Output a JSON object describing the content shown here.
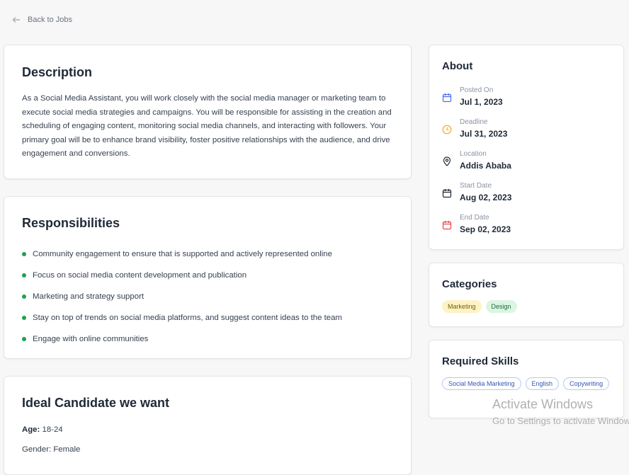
{
  "back": {
    "label": "Back to Jobs"
  },
  "description": {
    "title": "Description",
    "text": "As a Social Media Assistant, you will work closely with the social media manager or marketing team to execute social media strategies and campaigns. You will be responsible for assisting in the creation and scheduling of engaging content, monitoring social media channels, and interacting with followers. Your primary goal will be to enhance brand visibility, foster positive relationships with the audience, and drive engagement and conversions."
  },
  "responsibilities": {
    "title": "Responsibilities",
    "items": [
      "Community engagement to ensure that is supported and actively represented online",
      "Focus on social media content development and publication",
      "Marketing and strategy support",
      "Stay on top of trends on social media platforms, and suggest content ideas to the team",
      "Engage with online communities"
    ]
  },
  "ideal": {
    "title": "Ideal Candidate we want",
    "age_label": "Age:",
    "age_value": "18-24",
    "gender_label": "Gender: Female"
  },
  "about": {
    "title": "About",
    "rows": [
      {
        "label": "Posted On",
        "value": "Jul 1, 2023",
        "icon": "calendar-icon",
        "color": "#4a6cf7"
      },
      {
        "label": "Deadline",
        "value": "Jul 31, 2023",
        "icon": "clock-icon",
        "color": "#f5a524"
      },
      {
        "label": "Location",
        "value": "Addis Ababa",
        "icon": "location-pin-icon",
        "color": "#1f2937"
      },
      {
        "label": "Start Date",
        "value": "Aug 02, 2023",
        "icon": "calendar-icon",
        "color": "#1f2937"
      },
      {
        "label": "End Date",
        "value": "Sep 02, 2023",
        "icon": "calendar-icon",
        "color": "#e5484d"
      }
    ]
  },
  "categories": {
    "title": "Categories",
    "items": [
      "Marketing",
      "Design"
    ]
  },
  "skills": {
    "title": "Required Skills",
    "items": [
      "Social Media Marketing",
      "English",
      "Copywriting"
    ]
  },
  "watermark": {
    "line1": "Activate Windows",
    "line2": "Go to Settings to activate Windows."
  }
}
